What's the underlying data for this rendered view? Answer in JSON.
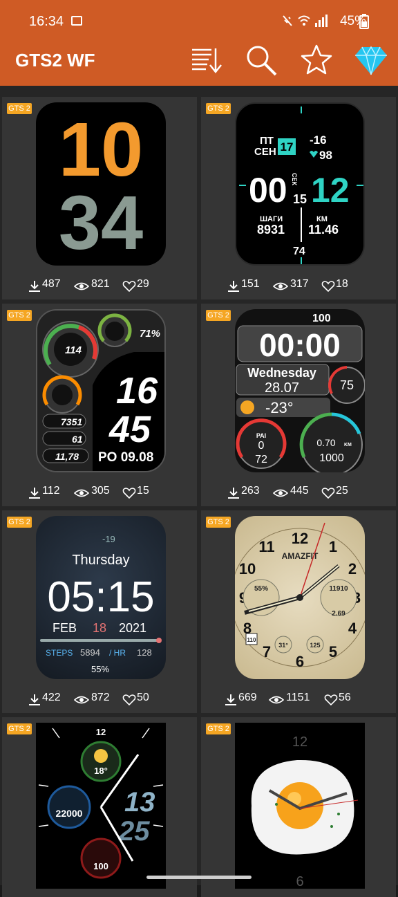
{
  "status_bar": {
    "time": "16:34",
    "battery": "45%"
  },
  "app_bar": {
    "title": "GTS2 WF",
    "icons": [
      "sort-download-icon",
      "search-icon",
      "star-icon",
      "diamond-icon"
    ]
  },
  "cards": [
    {
      "tag": "GTS 2",
      "downloads": "487",
      "views": "821",
      "likes": "29",
      "face": {
        "hour": "10",
        "minute": "34"
      }
    },
    {
      "tag": "GTS 2",
      "downloads": "151",
      "views": "317",
      "likes": "18",
      "face": {
        "day": "ПТ",
        "month": "СЕН",
        "date": "17",
        "temp": "-16",
        "hr": "98",
        "hours": "00",
        "minutes": "12",
        "sec_label": "СЕК",
        "seconds": "15",
        "steps_label": "ШАГИ",
        "steps": "8931",
        "km_label": "КМ",
        "km": "11.46",
        "battery": "74"
      }
    },
    {
      "tag": "GTS 2",
      "downloads": "112",
      "views": "305",
      "likes": "15",
      "face": {
        "hr": "114",
        "battery": "71%",
        "hour": "16",
        "minute": "45",
        "steps": "7351",
        "cal": "61",
        "dist": "11,78",
        "date": "PO 09.08"
      }
    },
    {
      "tag": "GTS 2",
      "downloads": "263",
      "views": "445",
      "likes": "25",
      "face": {
        "battery": "100",
        "time": "00:00",
        "weekday": "Wednesday",
        "date": "28.07",
        "hr": "75",
        "temp": "-23°",
        "pai_label": "PAI",
        "pai": "0",
        "pai_total": "72",
        "km": "0.70",
        "km_unit": "KM",
        "steps": "1000"
      }
    },
    {
      "tag": "GTS 2",
      "downloads": "422",
      "views": "872",
      "likes": "50",
      "face": {
        "temp": "-19",
        "weekday": "Thursday",
        "time": "05:15",
        "month": "FEB",
        "day": "18",
        "year": "2021",
        "steps_label": "STEPS",
        "steps": "5894",
        "hr_label": "/ HR",
        "hr": "128",
        "battery": "55%"
      }
    },
    {
      "tag": "GTS 2",
      "downloads": "669",
      "views": "1151",
      "likes": "56",
      "face": {
        "brand": "AMAZFIT",
        "hr_pct": "55%",
        "code": "11910",
        "dist": "2.69",
        "temp": "31°",
        "hr": "125",
        "date": "110"
      }
    },
    {
      "tag": "GTS 2",
      "face": {
        "n12": "12",
        "temp": "18°",
        "steps": "22000",
        "hour": "13",
        "minute": "25",
        "hr": "100"
      }
    },
    {
      "tag": "GTS 2",
      "face": {
        "n12": "12",
        "n6": "6"
      }
    }
  ],
  "colors": {
    "accent": "#cf5b25",
    "tag": "#f5a623",
    "card": "#353535"
  }
}
